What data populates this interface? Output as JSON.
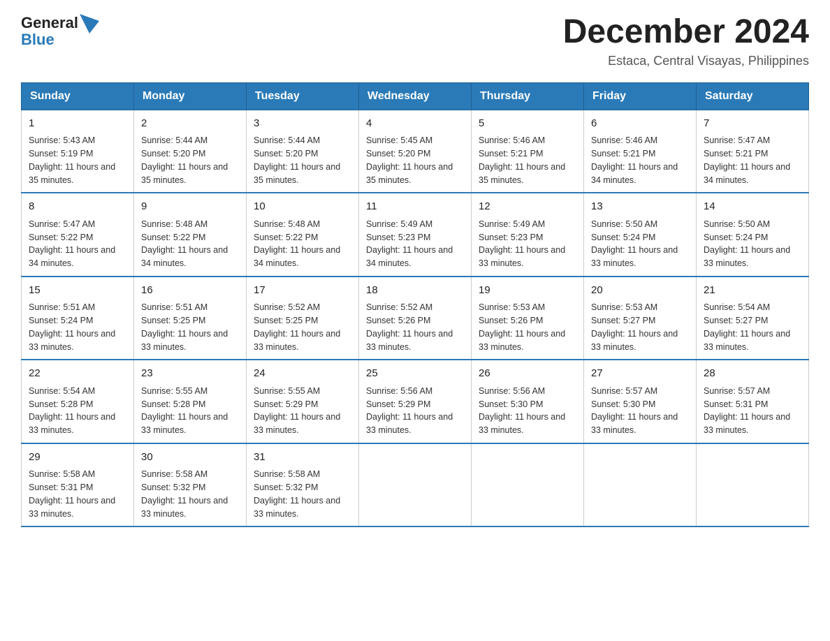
{
  "header": {
    "logo_general": "General",
    "logo_blue": "Blue",
    "title": "December 2024",
    "subtitle": "Estaca, Central Visayas, Philippines"
  },
  "days_of_week": [
    "Sunday",
    "Monday",
    "Tuesday",
    "Wednesday",
    "Thursday",
    "Friday",
    "Saturday"
  ],
  "weeks": [
    [
      {
        "day": "1",
        "sunrise": "Sunrise: 5:43 AM",
        "sunset": "Sunset: 5:19 PM",
        "daylight": "Daylight: 11 hours and 35 minutes."
      },
      {
        "day": "2",
        "sunrise": "Sunrise: 5:44 AM",
        "sunset": "Sunset: 5:20 PM",
        "daylight": "Daylight: 11 hours and 35 minutes."
      },
      {
        "day": "3",
        "sunrise": "Sunrise: 5:44 AM",
        "sunset": "Sunset: 5:20 PM",
        "daylight": "Daylight: 11 hours and 35 minutes."
      },
      {
        "day": "4",
        "sunrise": "Sunrise: 5:45 AM",
        "sunset": "Sunset: 5:20 PM",
        "daylight": "Daylight: 11 hours and 35 minutes."
      },
      {
        "day": "5",
        "sunrise": "Sunrise: 5:46 AM",
        "sunset": "Sunset: 5:21 PM",
        "daylight": "Daylight: 11 hours and 35 minutes."
      },
      {
        "day": "6",
        "sunrise": "Sunrise: 5:46 AM",
        "sunset": "Sunset: 5:21 PM",
        "daylight": "Daylight: 11 hours and 34 minutes."
      },
      {
        "day": "7",
        "sunrise": "Sunrise: 5:47 AM",
        "sunset": "Sunset: 5:21 PM",
        "daylight": "Daylight: 11 hours and 34 minutes."
      }
    ],
    [
      {
        "day": "8",
        "sunrise": "Sunrise: 5:47 AM",
        "sunset": "Sunset: 5:22 PM",
        "daylight": "Daylight: 11 hours and 34 minutes."
      },
      {
        "day": "9",
        "sunrise": "Sunrise: 5:48 AM",
        "sunset": "Sunset: 5:22 PM",
        "daylight": "Daylight: 11 hours and 34 minutes."
      },
      {
        "day": "10",
        "sunrise": "Sunrise: 5:48 AM",
        "sunset": "Sunset: 5:22 PM",
        "daylight": "Daylight: 11 hours and 34 minutes."
      },
      {
        "day": "11",
        "sunrise": "Sunrise: 5:49 AM",
        "sunset": "Sunset: 5:23 PM",
        "daylight": "Daylight: 11 hours and 34 minutes."
      },
      {
        "day": "12",
        "sunrise": "Sunrise: 5:49 AM",
        "sunset": "Sunset: 5:23 PM",
        "daylight": "Daylight: 11 hours and 33 minutes."
      },
      {
        "day": "13",
        "sunrise": "Sunrise: 5:50 AM",
        "sunset": "Sunset: 5:24 PM",
        "daylight": "Daylight: 11 hours and 33 minutes."
      },
      {
        "day": "14",
        "sunrise": "Sunrise: 5:50 AM",
        "sunset": "Sunset: 5:24 PM",
        "daylight": "Daylight: 11 hours and 33 minutes."
      }
    ],
    [
      {
        "day": "15",
        "sunrise": "Sunrise: 5:51 AM",
        "sunset": "Sunset: 5:24 PM",
        "daylight": "Daylight: 11 hours and 33 minutes."
      },
      {
        "day": "16",
        "sunrise": "Sunrise: 5:51 AM",
        "sunset": "Sunset: 5:25 PM",
        "daylight": "Daylight: 11 hours and 33 minutes."
      },
      {
        "day": "17",
        "sunrise": "Sunrise: 5:52 AM",
        "sunset": "Sunset: 5:25 PM",
        "daylight": "Daylight: 11 hours and 33 minutes."
      },
      {
        "day": "18",
        "sunrise": "Sunrise: 5:52 AM",
        "sunset": "Sunset: 5:26 PM",
        "daylight": "Daylight: 11 hours and 33 minutes."
      },
      {
        "day": "19",
        "sunrise": "Sunrise: 5:53 AM",
        "sunset": "Sunset: 5:26 PM",
        "daylight": "Daylight: 11 hours and 33 minutes."
      },
      {
        "day": "20",
        "sunrise": "Sunrise: 5:53 AM",
        "sunset": "Sunset: 5:27 PM",
        "daylight": "Daylight: 11 hours and 33 minutes."
      },
      {
        "day": "21",
        "sunrise": "Sunrise: 5:54 AM",
        "sunset": "Sunset: 5:27 PM",
        "daylight": "Daylight: 11 hours and 33 minutes."
      }
    ],
    [
      {
        "day": "22",
        "sunrise": "Sunrise: 5:54 AM",
        "sunset": "Sunset: 5:28 PM",
        "daylight": "Daylight: 11 hours and 33 minutes."
      },
      {
        "day": "23",
        "sunrise": "Sunrise: 5:55 AM",
        "sunset": "Sunset: 5:28 PM",
        "daylight": "Daylight: 11 hours and 33 minutes."
      },
      {
        "day": "24",
        "sunrise": "Sunrise: 5:55 AM",
        "sunset": "Sunset: 5:29 PM",
        "daylight": "Daylight: 11 hours and 33 minutes."
      },
      {
        "day": "25",
        "sunrise": "Sunrise: 5:56 AM",
        "sunset": "Sunset: 5:29 PM",
        "daylight": "Daylight: 11 hours and 33 minutes."
      },
      {
        "day": "26",
        "sunrise": "Sunrise: 5:56 AM",
        "sunset": "Sunset: 5:30 PM",
        "daylight": "Daylight: 11 hours and 33 minutes."
      },
      {
        "day": "27",
        "sunrise": "Sunrise: 5:57 AM",
        "sunset": "Sunset: 5:30 PM",
        "daylight": "Daylight: 11 hours and 33 minutes."
      },
      {
        "day": "28",
        "sunrise": "Sunrise: 5:57 AM",
        "sunset": "Sunset: 5:31 PM",
        "daylight": "Daylight: 11 hours and 33 minutes."
      }
    ],
    [
      {
        "day": "29",
        "sunrise": "Sunrise: 5:58 AM",
        "sunset": "Sunset: 5:31 PM",
        "daylight": "Daylight: 11 hours and 33 minutes."
      },
      {
        "day": "30",
        "sunrise": "Sunrise: 5:58 AM",
        "sunset": "Sunset: 5:32 PM",
        "daylight": "Daylight: 11 hours and 33 minutes."
      },
      {
        "day": "31",
        "sunrise": "Sunrise: 5:58 AM",
        "sunset": "Sunset: 5:32 PM",
        "daylight": "Daylight: 11 hours and 33 minutes."
      },
      {
        "day": "",
        "sunrise": "",
        "sunset": "",
        "daylight": ""
      },
      {
        "day": "",
        "sunrise": "",
        "sunset": "",
        "daylight": ""
      },
      {
        "day": "",
        "sunrise": "",
        "sunset": "",
        "daylight": ""
      },
      {
        "day": "",
        "sunrise": "",
        "sunset": "",
        "daylight": ""
      }
    ]
  ]
}
